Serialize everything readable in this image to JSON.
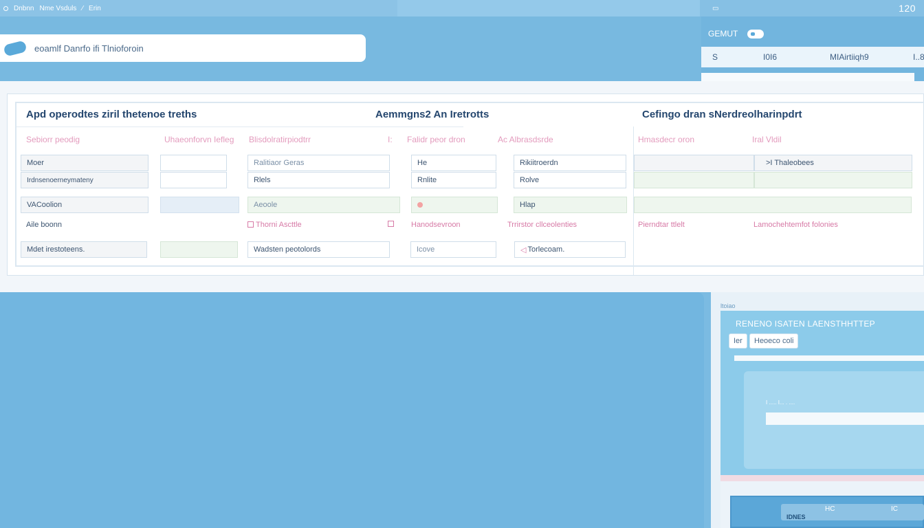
{
  "topbar": {
    "item1": "Dnbnn",
    "item2": "Nme Vsduls",
    "item3": "Erin",
    "right_num": "120"
  },
  "search": {
    "placeholder": "eoamlf Danrfo ifi Tlnioforoin"
  },
  "right_header": {
    "title": "GEMUT",
    "col1": "S",
    "col2": "I0I6",
    "col3": "MIAirtiiqh9",
    "col4": "I..8."
  },
  "table": {
    "sections": [
      "Apd operodtes ziril thetenoe treths",
      "Aemmgns2 An Iretrotts",
      "Cefingo dran sNerdreolharinpdrt"
    ],
    "column_headers": [
      "Sebiorr peodig",
      "Uhaeonforvn Iefleg",
      "Blisdolratirpiodtrr",
      "I:",
      "Falidr peor dron",
      "Ac Albrasdsrde",
      "Hmasdecr oron",
      "Iral Vldil"
    ],
    "row1": {
      "c1": "Moer",
      "c3": "Ralitiaor Geras",
      "c4": "He",
      "c5": "Rikiitroerdn",
      "c6": ">I  Thaleobees"
    },
    "row2": {
      "c1": "Irdnsenoerneymateny",
      "c3": "Rlels",
      "c4": "Rnlite",
      "c5": "Rolve"
    },
    "row3": {
      "c1": "VACoolion",
      "c3": "Aeoole",
      "c5": "Hlap"
    },
    "row4": {
      "c1": "Aile boonn",
      "c3": "Thorni Ascttle",
      "c4": "Hanodsevroon",
      "c5": "Trrirstor cllceolenties",
      "c6": "Pierndtar ttlelt",
      "c7": "Lamochehtemfot folonies"
    },
    "row5": {
      "c1": "Mdet irestoteens.",
      "c3": "Wadsten peotolords",
      "c4": "Icove",
      "c5": "Torlecoam."
    }
  },
  "side_card": {
    "top_text": "ltoiao",
    "title": "RENENO ISATEN LAENSTHHTTEP",
    "chip1": "Ier",
    "chip2": "Heoeco coli",
    "field_label": "I ..... I... . ....",
    "bottom_text1": "HC",
    "bottom_text2": "IDNES",
    "bottom_text3": "IC"
  }
}
